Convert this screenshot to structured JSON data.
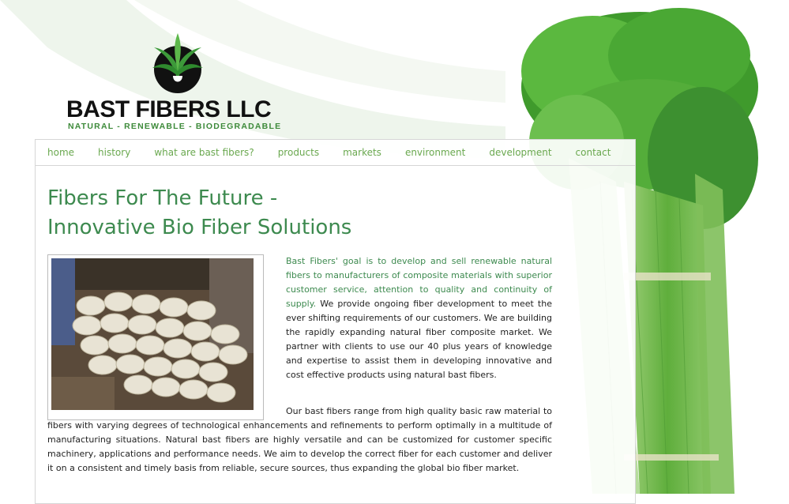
{
  "logo": {
    "title": "BAST FIBERS LLC",
    "tagline": "NATURAL - RENEWABLE - BIODEGRADABLE"
  },
  "nav": {
    "items": [
      {
        "label": "home"
      },
      {
        "label": "history"
      },
      {
        "label": "what are bast fibers?"
      },
      {
        "label": "products"
      },
      {
        "label": "markets"
      },
      {
        "label": "environment"
      },
      {
        "label": "development"
      },
      {
        "label": "contact"
      }
    ]
  },
  "main": {
    "heading_line1": "Fibers For The Future -",
    "heading_line2": "Innovative Bio Fiber Solutions",
    "para1_highlight": "Bast Fibers' goal is to develop and sell renewable natural fibers to manufacturers of composite materials with superior customer service, attention to quality and continuity of supply.",
    "para1_rest": " We provide ongoing fiber development to meet the ever shifting requirements of our customers. We are building the rapidly expanding natural fiber composite market. We partner with clients to use our 40 plus years of knowledge and expertise to assist them in developing innovative and cost effective products using natural bast fibers.",
    "para2": "Our bast fibers range from high quality basic raw material to fibers with varying degrees of technological enhancements and refinements to perform optimally in a multitude of manufacturing situations. Natural bast fibers are highly versatile and can be customized for customer specific machinery, applications and performance needs. We aim to develop the correct fiber for each customer and deliver it on a consistent and timely basis from reliable, secure sources, thus expanding the global bio fiber market."
  },
  "colors": {
    "accent_green": "#3d8a4f",
    "nav_green": "#6aa84f",
    "plant_green": "#4fae3a"
  },
  "icons": {
    "logo_mark": "hemp-leaf-logo-icon"
  }
}
